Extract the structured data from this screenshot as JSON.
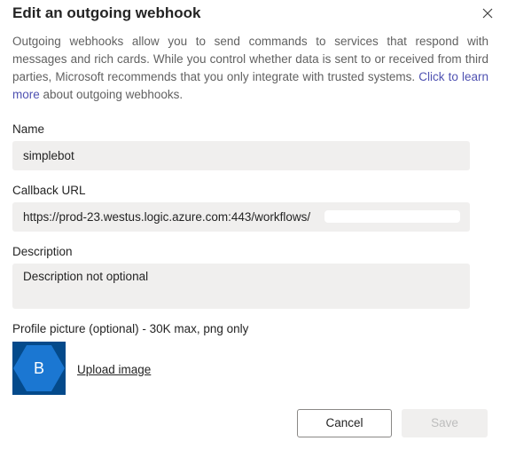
{
  "dialog": {
    "title": "Edit an outgoing webhook",
    "close_icon": "close-icon"
  },
  "intro": {
    "text_before_link": "Outgoing webhooks allow you to send commands to services that respond with messages and rich cards. While you control whether data is sent to or received from third parties, Microsoft recommends that you only integrate with trusted systems. ",
    "link_text": "Click to learn more",
    "text_after_link": " about outgoing webhooks."
  },
  "form": {
    "name": {
      "label": "Name",
      "value": "simplebot"
    },
    "callback_url": {
      "label": "Callback URL",
      "value": "https://prod-23.westus.logic.azure.com:443/workflows/"
    },
    "description": {
      "label": "Description",
      "value": "Description not optional"
    },
    "profile_picture": {
      "label": "Profile picture (optional) - 30K max, png only",
      "avatar_letter": "B",
      "upload_label": "Upload image"
    }
  },
  "footer": {
    "cancel_label": "Cancel",
    "save_label": "Save"
  },
  "colors": {
    "link": "#4f52b2",
    "avatar_background": "#044a8b",
    "avatar_hexagon": "#1b77d2",
    "field_background": "#f0efee"
  }
}
